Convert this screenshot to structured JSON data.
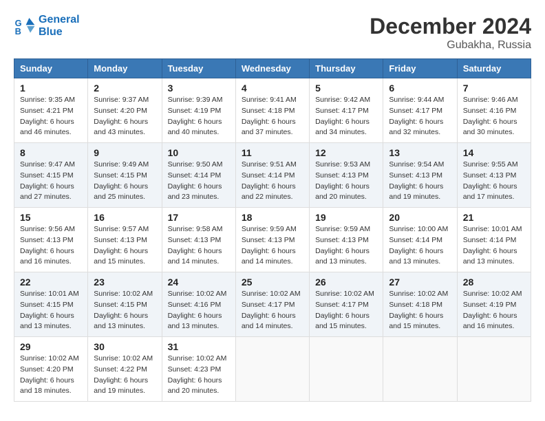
{
  "header": {
    "logo_line1": "General",
    "logo_line2": "Blue",
    "month": "December 2024",
    "location": "Gubakha, Russia"
  },
  "days_of_week": [
    "Sunday",
    "Monday",
    "Tuesday",
    "Wednesday",
    "Thursday",
    "Friday",
    "Saturday"
  ],
  "weeks": [
    [
      {
        "day": 1,
        "sunrise": "9:35 AM",
        "sunset": "4:21 PM",
        "daylight": "6 hours and 46 minutes."
      },
      {
        "day": 2,
        "sunrise": "9:37 AM",
        "sunset": "4:20 PM",
        "daylight": "6 hours and 43 minutes."
      },
      {
        "day": 3,
        "sunrise": "9:39 AM",
        "sunset": "4:19 PM",
        "daylight": "6 hours and 40 minutes."
      },
      {
        "day": 4,
        "sunrise": "9:41 AM",
        "sunset": "4:18 PM",
        "daylight": "6 hours and 37 minutes."
      },
      {
        "day": 5,
        "sunrise": "9:42 AM",
        "sunset": "4:17 PM",
        "daylight": "6 hours and 34 minutes."
      },
      {
        "day": 6,
        "sunrise": "9:44 AM",
        "sunset": "4:17 PM",
        "daylight": "6 hours and 32 minutes."
      },
      {
        "day": 7,
        "sunrise": "9:46 AM",
        "sunset": "4:16 PM",
        "daylight": "6 hours and 30 minutes."
      }
    ],
    [
      {
        "day": 8,
        "sunrise": "9:47 AM",
        "sunset": "4:15 PM",
        "daylight": "6 hours and 27 minutes."
      },
      {
        "day": 9,
        "sunrise": "9:49 AM",
        "sunset": "4:15 PM",
        "daylight": "6 hours and 25 minutes."
      },
      {
        "day": 10,
        "sunrise": "9:50 AM",
        "sunset": "4:14 PM",
        "daylight": "6 hours and 23 minutes."
      },
      {
        "day": 11,
        "sunrise": "9:51 AM",
        "sunset": "4:14 PM",
        "daylight": "6 hours and 22 minutes."
      },
      {
        "day": 12,
        "sunrise": "9:53 AM",
        "sunset": "4:13 PM",
        "daylight": "6 hours and 20 minutes."
      },
      {
        "day": 13,
        "sunrise": "9:54 AM",
        "sunset": "4:13 PM",
        "daylight": "6 hours and 19 minutes."
      },
      {
        "day": 14,
        "sunrise": "9:55 AM",
        "sunset": "4:13 PM",
        "daylight": "6 hours and 17 minutes."
      }
    ],
    [
      {
        "day": 15,
        "sunrise": "9:56 AM",
        "sunset": "4:13 PM",
        "daylight": "6 hours and 16 minutes."
      },
      {
        "day": 16,
        "sunrise": "9:57 AM",
        "sunset": "4:13 PM",
        "daylight": "6 hours and 15 minutes."
      },
      {
        "day": 17,
        "sunrise": "9:58 AM",
        "sunset": "4:13 PM",
        "daylight": "6 hours and 14 minutes."
      },
      {
        "day": 18,
        "sunrise": "9:59 AM",
        "sunset": "4:13 PM",
        "daylight": "6 hours and 14 minutes."
      },
      {
        "day": 19,
        "sunrise": "9:59 AM",
        "sunset": "4:13 PM",
        "daylight": "6 hours and 13 minutes."
      },
      {
        "day": 20,
        "sunrise": "10:00 AM",
        "sunset": "4:14 PM",
        "daylight": "6 hours and 13 minutes."
      },
      {
        "day": 21,
        "sunrise": "10:01 AM",
        "sunset": "4:14 PM",
        "daylight": "6 hours and 13 minutes."
      }
    ],
    [
      {
        "day": 22,
        "sunrise": "10:01 AM",
        "sunset": "4:15 PM",
        "daylight": "6 hours and 13 minutes."
      },
      {
        "day": 23,
        "sunrise": "10:02 AM",
        "sunset": "4:15 PM",
        "daylight": "6 hours and 13 minutes."
      },
      {
        "day": 24,
        "sunrise": "10:02 AM",
        "sunset": "4:16 PM",
        "daylight": "6 hours and 13 minutes."
      },
      {
        "day": 25,
        "sunrise": "10:02 AM",
        "sunset": "4:17 PM",
        "daylight": "6 hours and 14 minutes."
      },
      {
        "day": 26,
        "sunrise": "10:02 AM",
        "sunset": "4:17 PM",
        "daylight": "6 hours and 15 minutes."
      },
      {
        "day": 27,
        "sunrise": "10:02 AM",
        "sunset": "4:18 PM",
        "daylight": "6 hours and 15 minutes."
      },
      {
        "day": 28,
        "sunrise": "10:02 AM",
        "sunset": "4:19 PM",
        "daylight": "6 hours and 16 minutes."
      }
    ],
    [
      {
        "day": 29,
        "sunrise": "10:02 AM",
        "sunset": "4:20 PM",
        "daylight": "6 hours and 18 minutes."
      },
      {
        "day": 30,
        "sunrise": "10:02 AM",
        "sunset": "4:22 PM",
        "daylight": "6 hours and 19 minutes."
      },
      {
        "day": 31,
        "sunrise": "10:02 AM",
        "sunset": "4:23 PM",
        "daylight": "6 hours and 20 minutes."
      },
      null,
      null,
      null,
      null
    ]
  ]
}
